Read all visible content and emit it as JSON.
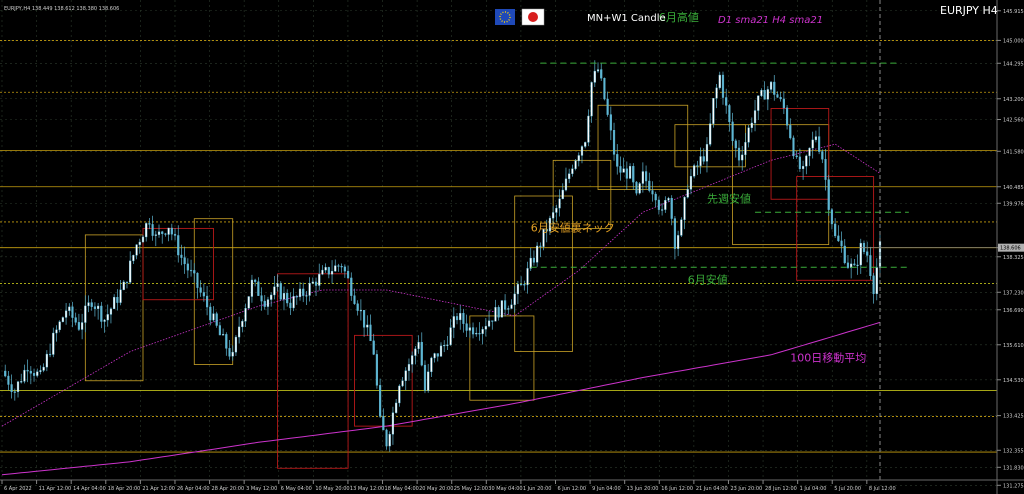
{
  "header": {
    "symbol_info": "EURJPY,H4  138.449 138.612 138.380 138.606",
    "template_label": "MN+W1 Candle",
    "ma_label": "D1 sma21 H4 sma21",
    "symbol_title": "EURJPY H4"
  },
  "flags": [
    {
      "name": "eu-flag-icon",
      "bg": "#1f49b8",
      "fg": "#ffd700"
    },
    {
      "name": "japan-flag-icon",
      "bg": "#ffffff",
      "fg": "#d81e1e"
    }
  ],
  "colors": {
    "background": "#000000",
    "grid": "#2c3a2c",
    "candle": "#5fb7d4",
    "candle_up_fill": "#ffffff",
    "monthly_box": "#c9a227",
    "weekly_box": "#b8191a",
    "annotation": "#3aad3a",
    "annotation_orange": "#e3a024",
    "sma_magenta": "#cc33cc",
    "sma_h4": "#b8860b",
    "hline_orange": "#c8a010",
    "hline_yellow": "#dede1e",
    "hline_red": "#b33a3a",
    "price_tag": "#b0b0b0"
  },
  "chart_data": {
    "type": "candlestick",
    "title": "EURJPY H4",
    "ylim": [
      131.5,
      146.0
    ],
    "y_ticks": [
      "145.915",
      "145.000",
      "144.295",
      "143.200",
      "142.560",
      "141.580",
      "140.485",
      "139.976",
      "138.606",
      "138.325",
      "137.230",
      "136.690",
      "135.610",
      "134.530",
      "133.425",
      "132.355",
      "131.830",
      "131.275"
    ],
    "x_ticks": [
      "6 Apr 2022",
      "11 Apr 12:00",
      "14 Apr 04:00",
      "18 Apr 20:00",
      "21 Apr 12:00",
      "26 Apr 04:00",
      "28 Apr 20:00",
      "3 May 12:00",
      "6 May 04:00",
      "10 May 20:00",
      "13 May 12:00",
      "18 May 04:00",
      "20 May 20:00",
      "25 May 12:00",
      "30 May 04:00",
      "1 Jun 20:00",
      "6 Jun 12:00",
      "9 Jun 04:00",
      "13 Jun 20:00",
      "16 Jun 12:00",
      "21 Jun 04:00",
      "23 Jun 20:00",
      "28 Jun 12:00",
      "1 Jul 04:00",
      "5 Jul 20:00",
      "8 Jul 12:00"
    ],
    "current_price": 138.606,
    "close_path": [
      [
        0,
        134.8
      ],
      [
        4,
        134.2
      ],
      [
        8,
        135.0
      ],
      [
        12,
        134.6
      ],
      [
        16,
        135.8
      ],
      [
        20,
        136.7
      ],
      [
        24,
        136.2
      ],
      [
        28,
        137.0
      ],
      [
        32,
        136.4
      ],
      [
        38,
        137.4
      ],
      [
        42,
        138.7
      ],
      [
        46,
        139.5
      ],
      [
        48,
        138.9
      ],
      [
        52,
        139.3
      ],
      [
        56,
        138.3
      ],
      [
        60,
        137.6
      ],
      [
        64,
        136.8
      ],
      [
        68,
        135.9
      ],
      [
        72,
        135.2
      ],
      [
        74,
        136.2
      ],
      [
        78,
        137.5
      ],
      [
        82,
        137.0
      ],
      [
        86,
        137.3
      ],
      [
        90,
        136.9
      ],
      [
        94,
        137.2
      ],
      [
        98,
        137.6
      ],
      [
        102,
        137.9
      ],
      [
        106,
        138.1
      ],
      [
        108,
        137.6
      ],
      [
        112,
        136.6
      ],
      [
        116,
        135.4
      ],
      [
        118,
        133.2
      ],
      [
        120,
        132.6
      ],
      [
        122,
        133.5
      ],
      [
        124,
        134.5
      ],
      [
        128,
        135.2
      ],
      [
        130,
        135.8
      ],
      [
        132,
        134.2
      ],
      [
        134,
        135.1
      ],
      [
        138,
        135.6
      ],
      [
        142,
        136.5
      ],
      [
        146,
        136.1
      ],
      [
        150,
        136.2
      ],
      [
        154,
        136.6
      ],
      [
        158,
        136.9
      ],
      [
        162,
        137.4
      ],
      [
        166,
        138.3
      ],
      [
        170,
        139.2
      ],
      [
        174,
        140.0
      ],
      [
        178,
        141.2
      ],
      [
        182,
        142.0
      ],
      [
        184,
        143.7
      ],
      [
        186,
        144.1
      ],
      [
        188,
        143.2
      ],
      [
        190,
        142.1
      ],
      [
        192,
        141.0
      ],
      [
        196,
        140.9
      ],
      [
        198,
        140.1
      ],
      [
        200,
        140.8
      ],
      [
        204,
        140.3
      ],
      [
        206,
        139.6
      ],
      [
        208,
        140.3
      ],
      [
        210,
        138.8
      ],
      [
        212,
        139.3
      ],
      [
        214,
        140.6
      ],
      [
        218,
        141.3
      ],
      [
        220,
        141.6
      ],
      [
        222,
        143.1
      ],
      [
        224,
        143.9
      ],
      [
        226,
        142.9
      ],
      [
        228,
        141.9
      ],
      [
        230,
        141.4
      ],
      [
        232,
        141.9
      ],
      [
        234,
        142.6
      ],
      [
        236,
        143.1
      ],
      [
        238,
        143.4
      ],
      [
        240,
        143.6
      ],
      [
        244,
        142.9
      ],
      [
        246,
        142.1
      ],
      [
        248,
        141.2
      ],
      [
        250,
        140.9
      ],
      [
        252,
        141.6
      ],
      [
        254,
        142.1
      ],
      [
        256,
        141.4
      ],
      [
        258,
        140.0
      ],
      [
        260,
        138.9
      ],
      [
        262,
        138.6
      ],
      [
        264,
        138.1
      ],
      [
        266,
        137.9
      ],
      [
        268,
        138.6
      ],
      [
        270,
        138.4
      ],
      [
        272,
        137.4
      ],
      [
        274,
        138.606
      ]
    ],
    "sma_long": [
      [
        0,
        131.6
      ],
      [
        40,
        132.0
      ],
      [
        80,
        132.6
      ],
      [
        120,
        133.1
      ],
      [
        160,
        133.8
      ],
      [
        200,
        134.6
      ],
      [
        240,
        135.3
      ],
      [
        274,
        136.3
      ]
    ],
    "sma_medium": [
      [
        0,
        133.1
      ],
      [
        40,
        135.4
      ],
      [
        80,
        136.8
      ],
      [
        100,
        137.3
      ],
      [
        120,
        137.3
      ],
      [
        140,
        136.9
      ],
      [
        160,
        136.5
      ],
      [
        180,
        137.9
      ],
      [
        200,
        139.7
      ],
      [
        220,
        140.5
      ],
      [
        240,
        141.3
      ],
      [
        260,
        141.8
      ],
      [
        274,
        140.9
      ]
    ],
    "monthly_boxes": [
      {
        "x0": 26,
        "x1": 44,
        "y0": 134.5,
        "y1": 139.0
      },
      {
        "x0": 60,
        "x1": 72,
        "y0": 135.0,
        "y1": 139.5
      },
      {
        "x0": 146,
        "x1": 166,
        "y0": 133.9,
        "y1": 136.5
      },
      {
        "x0": 160,
        "x1": 178,
        "y0": 135.4,
        "y1": 140.2
      },
      {
        "x0": 172,
        "x1": 190,
        "y0": 139.2,
        "y1": 141.3
      },
      {
        "x0": 186,
        "x1": 214,
        "y0": 140.4,
        "y1": 143.0
      },
      {
        "x0": 210,
        "x1": 232,
        "y0": 141.1,
        "y1": 142.4
      },
      {
        "x0": 228,
        "x1": 258,
        "y0": 138.7,
        "y1": 142.4
      }
    ],
    "weekly_boxes": [
      {
        "x0": 44,
        "x1": 66,
        "y0": 137.0,
        "y1": 139.2
      },
      {
        "x0": 86,
        "x1": 108,
        "y0": 131.8,
        "y1": 137.8
      },
      {
        "x0": 110,
        "x1": 128,
        "y0": 133.1,
        "y1": 135.9
      },
      {
        "x0": 240,
        "x1": 258,
        "y0": 140.1,
        "y1": 142.9
      },
      {
        "x0": 248,
        "x1": 272,
        "y0": 137.6,
        "y1": 140.8
      }
    ],
    "h_levels": [
      {
        "y": 145.0,
        "color": "orange",
        "style": "dotted"
      },
      {
        "y": 143.4,
        "color": "orange",
        "style": "dotted"
      },
      {
        "y": 141.6,
        "color": "orange",
        "style": "solid"
      },
      {
        "y": 140.485,
        "color": "orange",
        "style": "solid"
      },
      {
        "y": 139.4,
        "color": "orange",
        "style": "dotted"
      },
      {
        "y": 138.606,
        "color": "orange",
        "style": "solid"
      },
      {
        "y": 137.5,
        "color": "yellow",
        "style": "dotted"
      },
      {
        "y": 134.2,
        "color": "yellow",
        "style": "solid"
      },
      {
        "y": 133.4,
        "color": "orange",
        "style": "dotted"
      },
      {
        "y": 132.3,
        "color": "orange",
        "style": "solid"
      }
    ],
    "annotations": [
      {
        "text": "6月高値",
        "x": 205,
        "y": 145.6,
        "color": "green"
      },
      {
        "text": "先週安値",
        "x": 220,
        "y": 140.0,
        "color": "green"
      },
      {
        "text": "6月安値裏ネック",
        "x": 165,
        "y": 139.1,
        "color": "orange"
      },
      {
        "text": "6月安値",
        "x": 214,
        "y": 137.5,
        "color": "green"
      },
      {
        "text": "100日移動平均",
        "x": 246,
        "y": 135.1,
        "color": "magenta"
      }
    ],
    "dashed_levels": [
      {
        "y": 144.3,
        "x0": 168,
        "x1": 280
      },
      {
        "y": 139.7,
        "x0": 235,
        "x1": 283
      },
      {
        "y": 138.0,
        "x0": 165,
        "x1": 283
      }
    ]
  }
}
